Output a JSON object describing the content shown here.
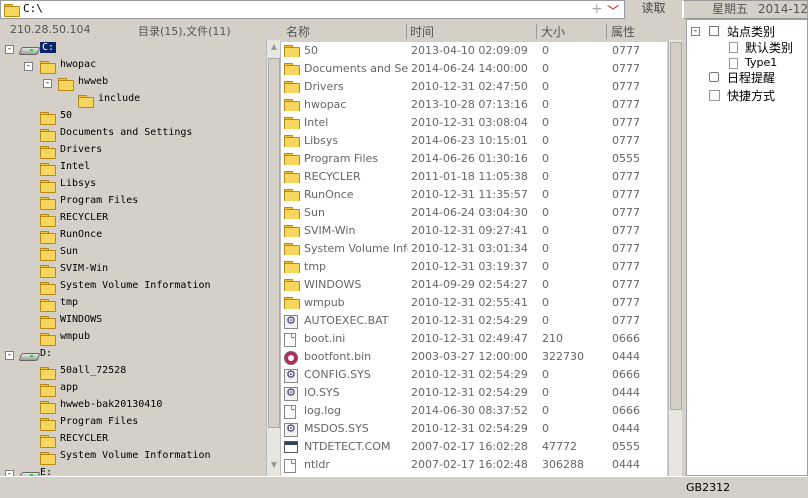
{
  "path_bar": {
    "path": "C:\\",
    "plus": "+",
    "read_button": "读取",
    "weekday": "星期五",
    "date": "2014-12-05"
  },
  "status": {
    "ip": "210.28.50.104",
    "dir_count": "目录(15),文件(11)"
  },
  "tree": [
    {
      "label": "C:",
      "type": "drive",
      "expander": "-",
      "selected": true
    },
    {
      "label": "hwopac",
      "type": "folder",
      "expander": "-"
    },
    {
      "label": "hwweb",
      "type": "folder",
      "expander": "-"
    },
    {
      "label": "include",
      "type": "folder"
    },
    {
      "label": "50",
      "type": "folder"
    },
    {
      "label": "Documents and Settings",
      "type": "folder"
    },
    {
      "label": "Drivers",
      "type": "folder"
    },
    {
      "label": "Intel",
      "type": "folder"
    },
    {
      "label": "Libsys",
      "type": "folder"
    },
    {
      "label": "Program Files",
      "type": "folder"
    },
    {
      "label": "RECYCLER",
      "type": "folder"
    },
    {
      "label": "RunOnce",
      "type": "folder"
    },
    {
      "label": "Sun",
      "type": "folder"
    },
    {
      "label": "SVIM-Win",
      "type": "folder"
    },
    {
      "label": "System Volume Information",
      "type": "folder"
    },
    {
      "label": "tmp",
      "type": "folder"
    },
    {
      "label": "WINDOWS",
      "type": "folder"
    },
    {
      "label": "wmpub",
      "type": "folder"
    },
    {
      "label": "D:",
      "type": "drive",
      "expander": "-"
    },
    {
      "label": "50all_72528",
      "type": "folder"
    },
    {
      "label": "app",
      "type": "folder"
    },
    {
      "label": "hwweb-bak20130410",
      "type": "folder"
    },
    {
      "label": "Program Files",
      "type": "folder"
    },
    {
      "label": "RECYCLER",
      "type": "folder"
    },
    {
      "label": "System Volume Information",
      "type": "folder"
    },
    {
      "label": "E:",
      "type": "drive",
      "expander": "-"
    }
  ],
  "columns": {
    "name": "名称",
    "time": "时间",
    "size": "大小",
    "attr": "属性"
  },
  "files": [
    {
      "name": "50",
      "time": "2013-04-10 02:09:09",
      "size": "0",
      "attr": "0777",
      "icon": "folder-icon"
    },
    {
      "name": "Documents and Set...",
      "time": "2014-06-24 14:00:00",
      "size": "0",
      "attr": "0777",
      "icon": "folder-icon"
    },
    {
      "name": "Drivers",
      "time": "2010-12-31 02:47:50",
      "size": "0",
      "attr": "0777",
      "icon": "folder-icon"
    },
    {
      "name": "hwopac",
      "time": "2013-10-28 07:13:16",
      "size": "0",
      "attr": "0777",
      "icon": "folder-icon"
    },
    {
      "name": "Intel",
      "time": "2010-12-31 03:08:04",
      "size": "0",
      "attr": "0777",
      "icon": "folder-icon"
    },
    {
      "name": "Libsys",
      "time": "2014-06-23 10:15:01",
      "size": "0",
      "attr": "0777",
      "icon": "folder-icon"
    },
    {
      "name": "Program Files",
      "time": "2014-06-26 01:30:16",
      "size": "0",
      "attr": "0555",
      "icon": "folder-icon"
    },
    {
      "name": "RECYCLER",
      "time": "2011-01-18 11:05:38",
      "size": "0",
      "attr": "0777",
      "icon": "folder-icon"
    },
    {
      "name": "RunOnce",
      "time": "2010-12-31 11:35:57",
      "size": "0",
      "attr": "0777",
      "icon": "folder-icon"
    },
    {
      "name": "Sun",
      "time": "2014-06-24 03:04:30",
      "size": "0",
      "attr": "0777",
      "icon": "folder-icon"
    },
    {
      "name": "SVIM-Win",
      "time": "2010-12-31 09:27:41",
      "size": "0",
      "attr": "0777",
      "icon": "folder-icon"
    },
    {
      "name": "System Volume Info...",
      "time": "2010-12-31 03:01:34",
      "size": "0",
      "attr": "0777",
      "icon": "folder-icon"
    },
    {
      "name": "tmp",
      "time": "2010-12-31 03:19:37",
      "size": "0",
      "attr": "0777",
      "icon": "folder-icon"
    },
    {
      "name": "WINDOWS",
      "time": "2014-09-29 02:54:27",
      "size": "0",
      "attr": "0777",
      "icon": "folder-icon"
    },
    {
      "name": "wmpub",
      "time": "2010-12-31 02:55:41",
      "size": "0",
      "attr": "0777",
      "icon": "folder-icon"
    },
    {
      "name": "AUTOEXEC.BAT",
      "time": "2010-12-31 02:54:29",
      "size": "0",
      "attr": "0777",
      "icon": "gear-file-icon"
    },
    {
      "name": "boot.ini",
      "time": "2010-12-31 02:49:47",
      "size": "210",
      "attr": "0666",
      "icon": "file-icon"
    },
    {
      "name": "bootfont.bin",
      "time": "2003-03-27 12:00:00",
      "size": "322730",
      "attr": "0444",
      "icon": "binary-file-icon"
    },
    {
      "name": "CONFIG.SYS",
      "time": "2010-12-31 02:54:29",
      "size": "0",
      "attr": "0666",
      "icon": "gear-file-icon"
    },
    {
      "name": "IO.SYS",
      "time": "2010-12-31 02:54:29",
      "size": "0",
      "attr": "0444",
      "icon": "gear-file-icon"
    },
    {
      "name": "log.log",
      "time": "2014-06-30 08:37:52",
      "size": "0",
      "attr": "0666",
      "icon": "file-icon"
    },
    {
      "name": "MSDOS.SYS",
      "time": "2010-12-31 02:54:29",
      "size": "0",
      "attr": "0444",
      "icon": "gear-file-icon"
    },
    {
      "name": "NTDETECT.COM",
      "time": "2007-02-17 16:02:28",
      "size": "47772",
      "attr": "0555",
      "icon": "exe-file-icon"
    },
    {
      "name": "ntldr",
      "time": "2007-02-17 16:02:48",
      "size": "306288",
      "attr": "0444",
      "icon": "file-icon"
    }
  ],
  "right_panel": {
    "site_category": "站点类别",
    "default_category": "默认类别",
    "type1": "Type1",
    "schedule": "日程提醒",
    "shortcuts": "快捷方式"
  },
  "status_bar": {
    "encoding": "GB2312"
  }
}
